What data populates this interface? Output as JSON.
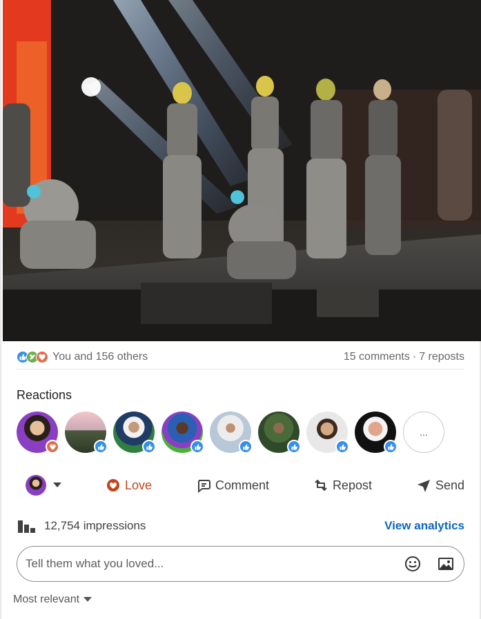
{
  "colors": {
    "link": "#0a66c2",
    "love": "#c3431a",
    "like": "#378fe9",
    "support": "#6dae4f"
  },
  "video": {
    "description_icon": "video-frame"
  },
  "social_counts": {
    "reaction_icons": [
      "like-icon",
      "support-icon",
      "love-icon"
    ],
    "summary": "You and 156 others",
    "comments": "15 comments",
    "separator": "·",
    "reposts": "7 reposts"
  },
  "reactions": {
    "title": "Reactions",
    "reactors": [
      {
        "badge": "love-icon"
      },
      {
        "badge": "like-icon"
      },
      {
        "badge": "like-icon"
      },
      {
        "badge": "like-icon"
      },
      {
        "badge": "like-icon"
      },
      {
        "badge": "like-icon"
      },
      {
        "badge": "like-icon"
      },
      {
        "badge": "like-icon"
      }
    ],
    "more_label": "..."
  },
  "actions": {
    "love": "Love",
    "comment": "Comment",
    "repost": "Repost",
    "send": "Send"
  },
  "impressions": {
    "label": "12,754 impressions",
    "analytics": "View analytics"
  },
  "comment_box": {
    "placeholder": "Tell them what you loved..."
  },
  "sort": {
    "label": "Most relevant"
  }
}
